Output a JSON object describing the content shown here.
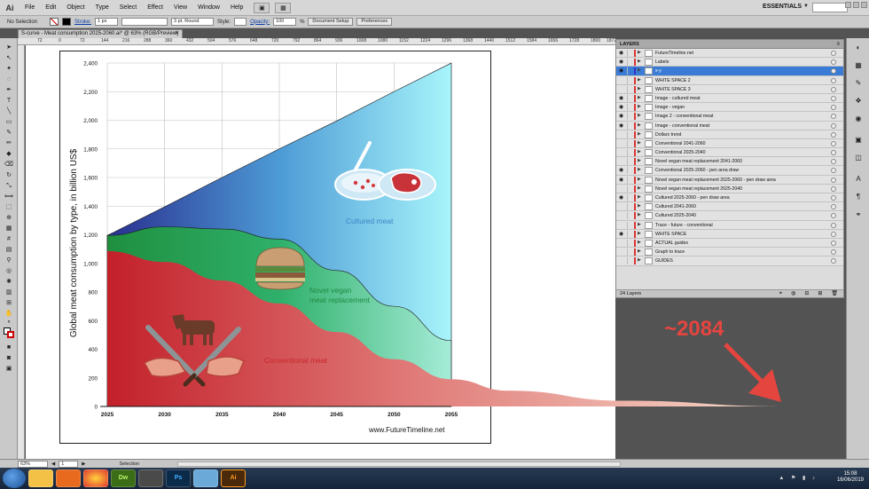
{
  "menubar": {
    "app": "Ai",
    "items": [
      "File",
      "Edit",
      "Object",
      "Type",
      "Select",
      "Effect",
      "View",
      "Window",
      "Help"
    ],
    "workspace": "ESSENTIALS"
  },
  "control": {
    "selection": "No Selection",
    "stroke_label": "Stroke:",
    "stroke_weight": "1 px",
    "brush": "3 pt. Round",
    "style_label": "Style:",
    "opacity_label": "Opacity:",
    "opacity_value": "100",
    "opacity_unit": "%",
    "doc_setup": "Document Setup",
    "preferences": "Preferences"
  },
  "document": {
    "tab": "S-curve - Meat consumption 2025-2060.ai* @ 63% (RGB/Preview)"
  },
  "ruler": [
    "72",
    "0",
    "72",
    "144",
    "216",
    "288",
    "360",
    "432",
    "504",
    "576",
    "648",
    "720",
    "792",
    "864",
    "936",
    "1008",
    "1080",
    "1152",
    "1224",
    "1296",
    "1368",
    "1440",
    "1512",
    "1584",
    "1656",
    "1728",
    "1800",
    "1872"
  ],
  "chart_data": {
    "type": "area",
    "ylabel": "Global meat consumption by type, in billion US$",
    "x": [
      2025,
      2030,
      2035,
      2040,
      2045,
      2050,
      2055
    ],
    "x_ticks": [
      "2025",
      "2030",
      "2035",
      "2040",
      "2045",
      "2050",
      "2055"
    ],
    "y_ticks": [
      "0",
      "200",
      "400",
      "600",
      "800",
      "1,000",
      "1,200",
      "1,400",
      "1,600",
      "1,800",
      "2,000",
      "2,200",
      "2,400"
    ],
    "ylim": [
      0,
      2400
    ],
    "xlim": [
      2025,
      2055
    ],
    "grid": true,
    "series": [
      {
        "name": "Conventional meat",
        "x": [
          2025,
          2030,
          2035,
          2040,
          2045,
          2050,
          2055,
          2060,
          2070,
          2084
        ],
        "values": [
          1085,
          1010,
          880,
          720,
          520,
          330,
          190,
          110,
          40,
          0
        ],
        "color": "#c8262b"
      },
      {
        "name": "Novel vegan meat replacement",
        "x": [
          2025,
          2030,
          2035,
          2040,
          2045,
          2050,
          2055
        ],
        "values": [
          1195,
          1255,
          1240,
          1170,
          950,
          700,
          460
        ],
        "color": "#1e9a48"
      },
      {
        "name": "Cultured meat",
        "x": [
          2025,
          2030,
          2035,
          2040,
          2045,
          2050,
          2055
        ],
        "values": [
          1195,
          1395,
          1600,
          1800,
          1995,
          2200,
          2400
        ],
        "color": "#2d3a9a"
      }
    ],
    "annotations": {
      "cultured": "Cultured meat",
      "vegan_line1": "Novel vegan",
      "vegan_line2": "meat replacement",
      "conventional": "Conventional meat",
      "source": "www.FutureTimeline.net",
      "forecast": "~2084"
    }
  },
  "layers": {
    "title": "LAYERS",
    "rows": [
      {
        "name": "FutureTimeline.net",
        "color": "#d33",
        "visible": true
      },
      {
        "name": "Labels",
        "color": "#d33",
        "visible": true
      },
      {
        "name": "x-y",
        "color": "#33c",
        "visible": true,
        "selected": true
      },
      {
        "name": "WHITE SPACE 2",
        "color": "#d33",
        "visible": false
      },
      {
        "name": "WHITE SPACE 3",
        "color": "#d33",
        "visible": false
      },
      {
        "name": "Image - cultured meat",
        "color": "#d33",
        "visible": true
      },
      {
        "name": "Image - vegan",
        "color": "#d33",
        "visible": true
      },
      {
        "name": "Image 2 - conventional meat",
        "color": "#d33",
        "visible": true
      },
      {
        "name": "Image - conventional meat",
        "color": "#d33",
        "visible": true
      },
      {
        "name": "Dollars trend",
        "color": "#d33",
        "visible": false
      },
      {
        "name": "Conventional 2041-2060",
        "color": "#d33",
        "visible": false
      },
      {
        "name": "Conventional 2025-2040",
        "color": "#d33",
        "visible": false
      },
      {
        "name": "Novel vegan meat replacement 2041-2060",
        "color": "#d33",
        "visible": false
      },
      {
        "name": "Conventional 2025-2060 - pen area draw",
        "color": "#d33",
        "visible": true
      },
      {
        "name": "Novel vegan meat replacement 2025-2060 - pen draw area",
        "color": "#d33",
        "visible": true
      },
      {
        "name": "Novel vegan meat replacement 2025-2040",
        "color": "#d33",
        "visible": false
      },
      {
        "name": "Cultured 2025-2060 - pen draw area",
        "color": "#d33",
        "visible": true
      },
      {
        "name": "Cultured 2041-2060",
        "color": "#d33",
        "visible": false
      },
      {
        "name": "Cultured 2025-2040",
        "color": "#d33",
        "visible": false
      },
      {
        "name": "Trace - future - conventional",
        "color": "#d33",
        "visible": false
      },
      {
        "name": "WHITE SPACE",
        "color": "#d33",
        "visible": true
      },
      {
        "name": "ACTUAL guides",
        "color": "#d33",
        "visible": false
      },
      {
        "name": "Graph to trace",
        "color": "#d33",
        "visible": false
      },
      {
        "name": "GUIDES",
        "color": "#d33",
        "visible": false
      }
    ],
    "count": "24 Layers"
  },
  "status": {
    "zoom": "63%",
    "page": "1",
    "tool": "Selection"
  },
  "taskbar": {
    "apps": [
      "",
      "",
      "",
      "Dw",
      "",
      "Ps",
      "",
      "Ai"
    ],
    "time": "15:08",
    "date": "16/06/2019"
  }
}
